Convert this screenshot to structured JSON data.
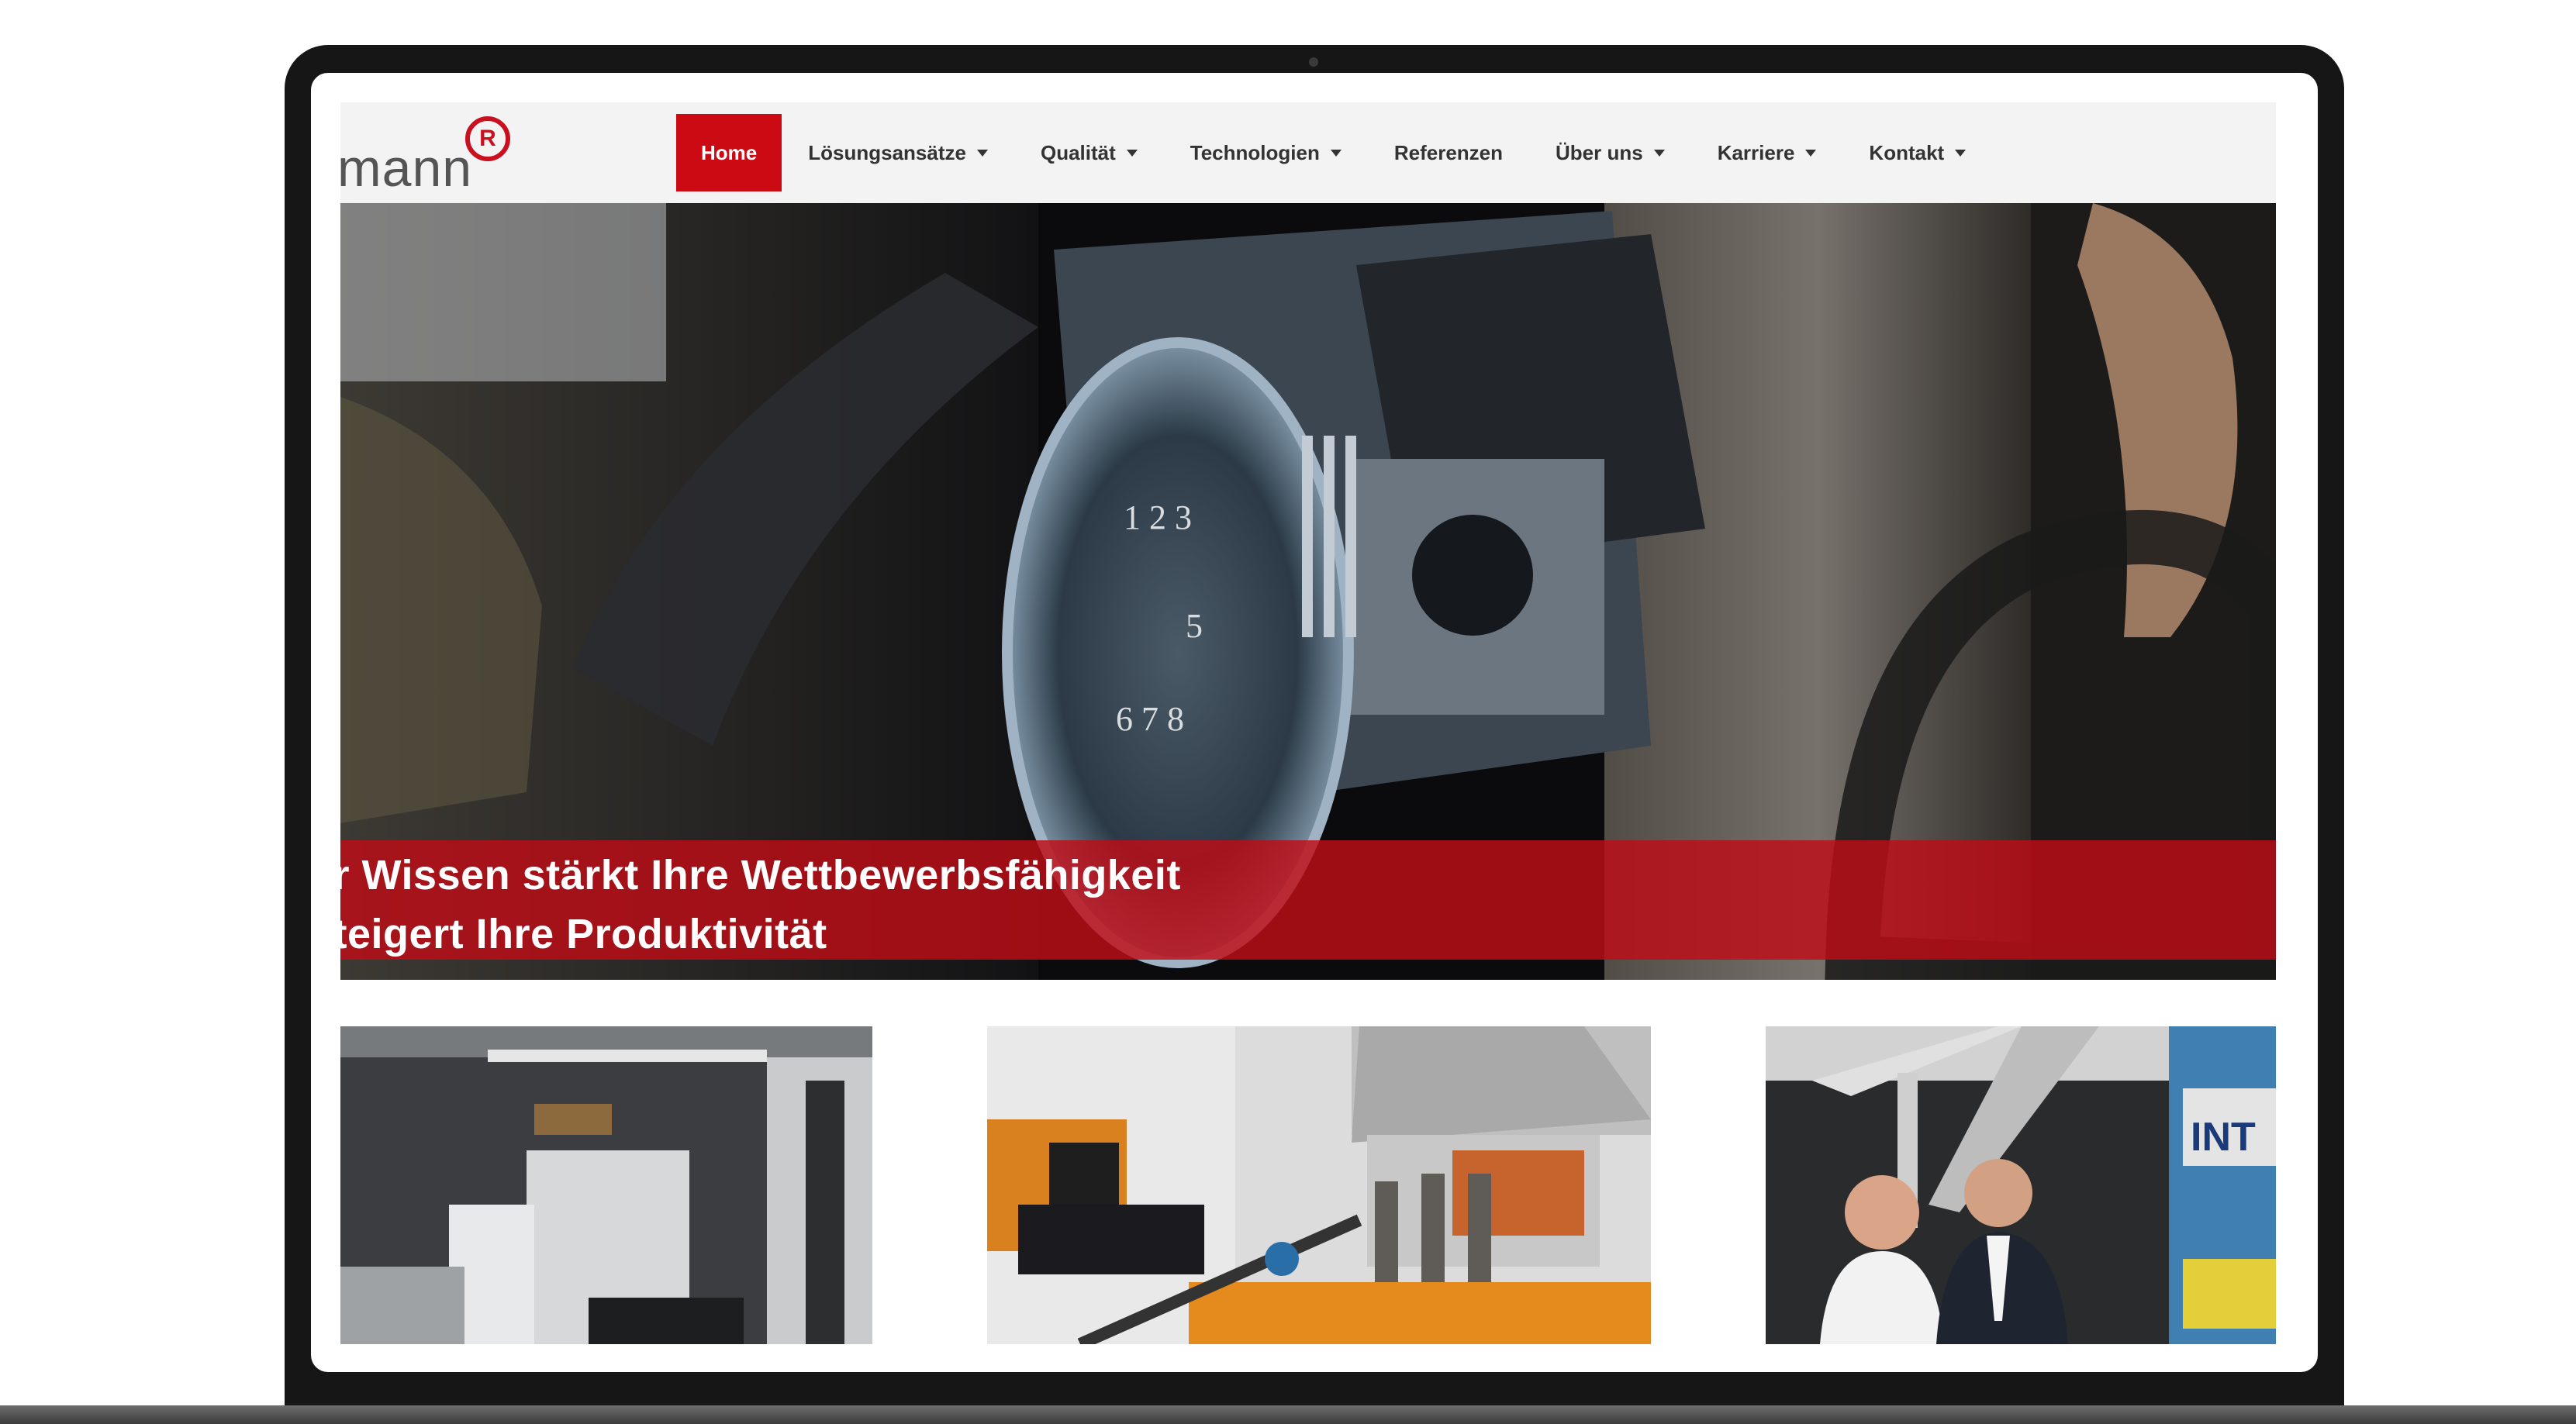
{
  "site": {
    "logo_text": "mann",
    "logo_mark": "R"
  },
  "nav": {
    "items": [
      {
        "label": "Home",
        "active": true,
        "dropdown": false
      },
      {
        "label": "Lösungsansätze",
        "active": false,
        "dropdown": true
      },
      {
        "label": "Qualität",
        "active": false,
        "dropdown": true
      },
      {
        "label": "Technologien",
        "active": false,
        "dropdown": true
      },
      {
        "label": "Referenzen",
        "active": false,
        "dropdown": false
      },
      {
        "label": "Über uns",
        "active": false,
        "dropdown": true
      },
      {
        "label": "Karriere",
        "active": false,
        "dropdown": true
      },
      {
        "label": "Kontakt",
        "active": false,
        "dropdown": true
      }
    ]
  },
  "hero": {
    "line1": "er Wissen stärkt Ihre Wettbewerbsfähigkeit",
    "line2": "steigert Ihre Produktivität"
  },
  "tiles": {
    "tile3_sign": "INT"
  },
  "colors": {
    "brand_red": "#cc0a14",
    "header_bg": "#f3f3f3",
    "bezel": "#161616"
  }
}
